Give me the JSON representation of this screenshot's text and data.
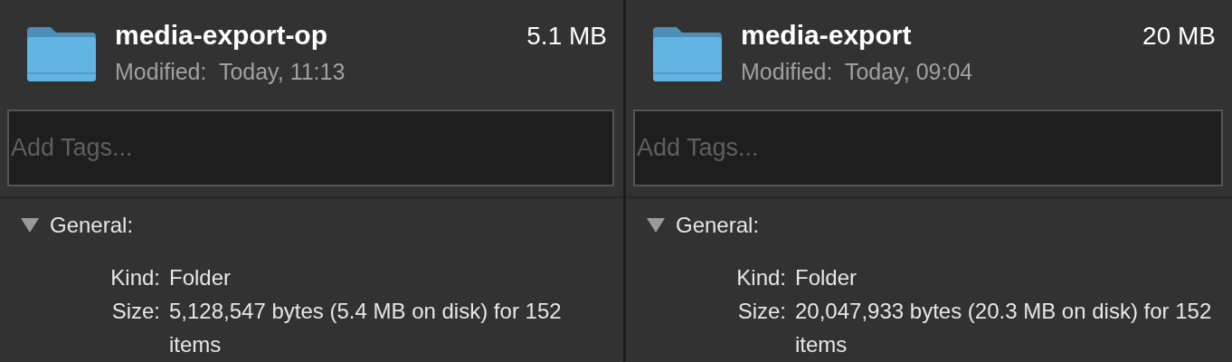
{
  "panels": [
    {
      "name": "media-export-op",
      "size": "5.1 MB",
      "modified_label": "Modified:",
      "modified_value": "Today, 11:13",
      "tags_placeholder": "Add Tags...",
      "section": {
        "title": "General:",
        "expanded": true,
        "rows": [
          {
            "label": "Kind:",
            "value": "Folder"
          },
          {
            "label": "Size:",
            "value": "5,128,547 bytes (5.4 MB on disk) for 152 items"
          }
        ]
      }
    },
    {
      "name": "media-export",
      "size": "20 MB",
      "modified_label": "Modified:",
      "modified_value": "Today, 09:04",
      "tags_placeholder": "Add Tags...",
      "section": {
        "title": "General:",
        "expanded": true,
        "rows": [
          {
            "label": "Kind:",
            "value": "Folder"
          },
          {
            "label": "Size:",
            "value": "20,047,933 bytes (20.3 MB on disk) for 152 items"
          }
        ]
      }
    }
  ]
}
